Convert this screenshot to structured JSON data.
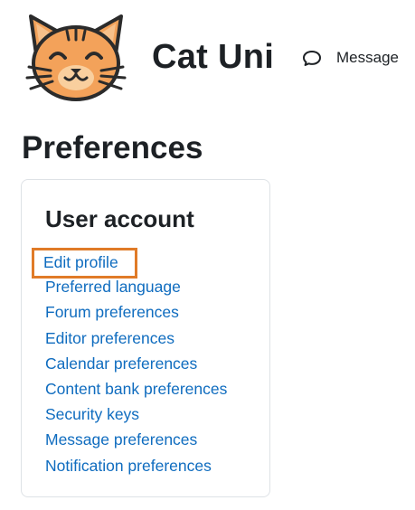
{
  "header": {
    "site_name": "Cat Uni",
    "logo_icon": "cat-face-icon",
    "message_label": "Message",
    "message_icon": "chat-bubble-icon"
  },
  "page": {
    "title": "Preferences"
  },
  "user_account": {
    "heading": "User account",
    "highlight_color": "#e07b28",
    "link_color": "#0f6cbf",
    "items": [
      {
        "label": "Edit profile"
      },
      {
        "label": "Preferred language"
      },
      {
        "label": "Forum preferences"
      },
      {
        "label": "Editor preferences"
      },
      {
        "label": "Calendar preferences"
      },
      {
        "label": "Content bank preferences"
      },
      {
        "label": "Security keys"
      },
      {
        "label": "Message preferences"
      },
      {
        "label": "Notification preferences"
      }
    ]
  }
}
